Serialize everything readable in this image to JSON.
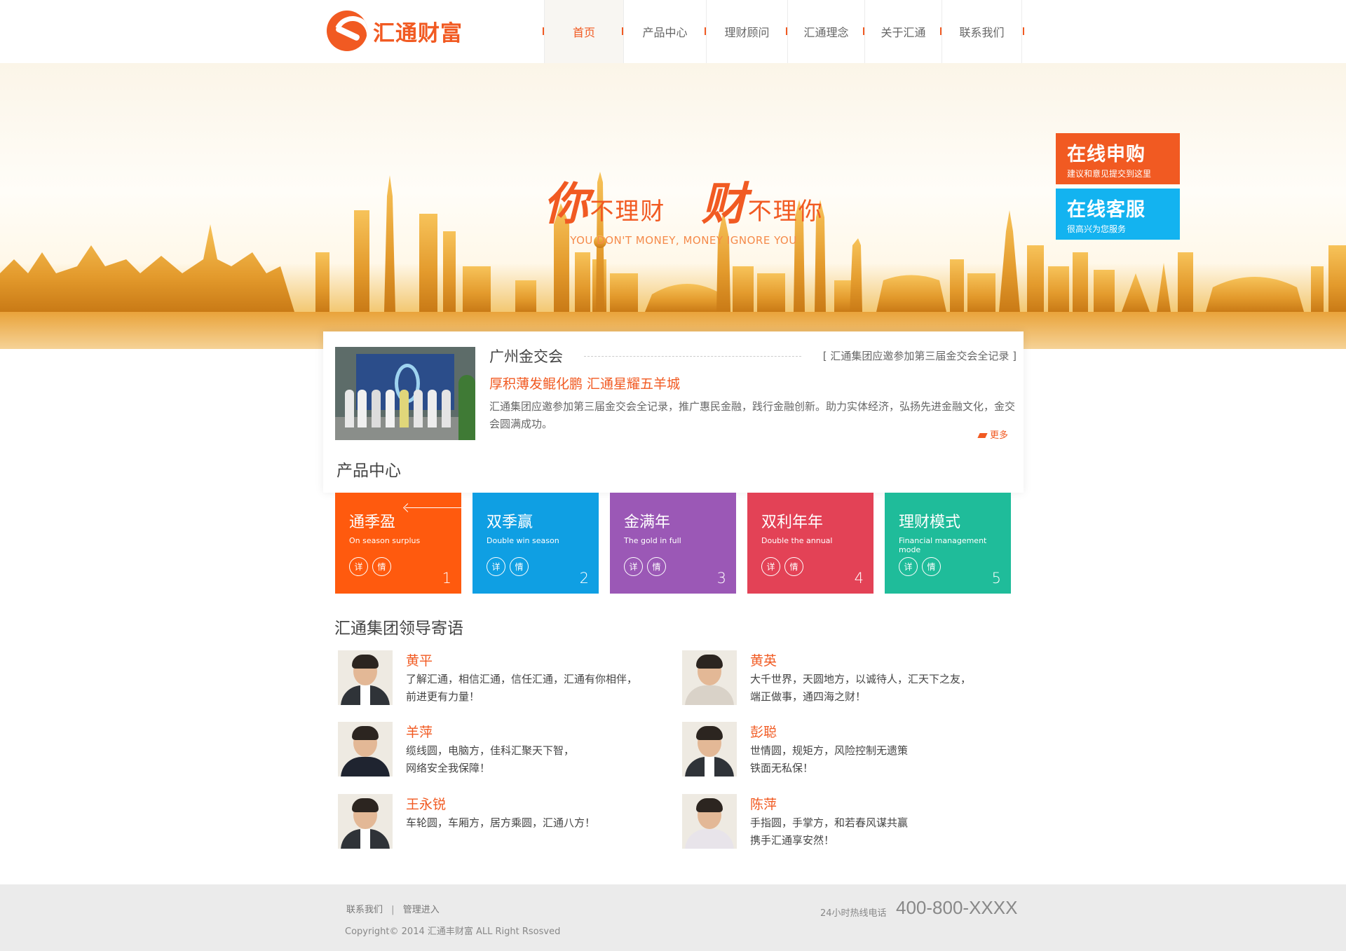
{
  "brand": {
    "name": "汇通财富"
  },
  "nav": {
    "items": [
      {
        "label": "首页",
        "active": true
      },
      {
        "label": "产品中心",
        "active": false
      },
      {
        "label": "理财顾问",
        "active": false
      },
      {
        "label": "汇通理念",
        "active": false
      },
      {
        "label": "关于汇通",
        "active": false
      },
      {
        "label": "联系我们",
        "active": false
      }
    ]
  },
  "banner": {
    "slogan_big1": "你",
    "slogan_small1": "不理财",
    "slogan_big2": "财",
    "slogan_small2": "不理你",
    "slogan_en": "YOU DON'T MONEY, MONEY IGNORE YOU",
    "slide_count": 3,
    "active_slide": 2
  },
  "side_buttons": {
    "apply": {
      "title": "在线申购",
      "subtitle": "建议和意见提交到这里"
    },
    "service": {
      "title": "在线客服",
      "subtitle": "很高兴为您服务"
    }
  },
  "news": {
    "title": "广州金交会",
    "tag": "[ 汇通集团应邀参加第三届金交会全记录 ]",
    "headline": "厚积薄发鲲化鹏 汇通星耀五羊城",
    "body": "汇通集团应邀参加第三届金交会全记录，推广惠民金融，践行金融创新。助力实体经济，弘扬先进金融文化，金交会圆满成功。",
    "more": "更多"
  },
  "products": {
    "title": "产品中心",
    "detail_chars": [
      "详",
      "情"
    ],
    "items": [
      {
        "name": "通季盈",
        "en": "On season surplus",
        "num": "1",
        "color": "#ff5a0e"
      },
      {
        "name": "双季赢",
        "en": "Double win season",
        "num": "2",
        "color": "#0f9fe3"
      },
      {
        "name": "金满年",
        "en": "The gold in full",
        "num": "3",
        "color": "#9b58b6"
      },
      {
        "name": "双利年年",
        "en": "Double the annual",
        "num": "4",
        "color": "#e34256"
      },
      {
        "name": "理财模式",
        "en": "Financial management mode",
        "num": "5",
        "color": "#1fbc9a"
      }
    ]
  },
  "leaders": {
    "title": "汇通集团领导寄语",
    "items": [
      {
        "name": "黄平",
        "line1": "了解汇通，相信汇通，信任汇通，汇通有你相伴，",
        "line2": "前进更有力量！"
      },
      {
        "name": "黄英",
        "line1": "大千世界，天圆地方，以诚待人，汇天下之友，",
        "line2": "端正做事，通四海之财！"
      },
      {
        "name": "羊萍",
        "line1": "缆线圆，电脑方，佳科汇聚天下智，",
        "line2": "网络安全我保障！"
      },
      {
        "name": "彭聪",
        "line1": "世情圆，规矩方，风险控制无遗策",
        "line2": "铁面无私保！"
      },
      {
        "name": "王永锐",
        "line1": "车轮圆，车厢方，居方乘圆，汇通八方！",
        "line2": ""
      },
      {
        "name": "陈萍",
        "line1": "手指圆，手掌方，和若春风谋共赢",
        "line2": "携手汇通享安然！"
      }
    ]
  },
  "footer": {
    "link_contact": "联系我们",
    "separator": "|",
    "link_admin": "管理进入",
    "copyright": "Copyright© 2014 汇通丰财富 ALL Right Rsosved",
    "hotline_label": "24小时热线电话",
    "phone": "400-800-XXXX"
  },
  "colors": {
    "accent": "#f15a22",
    "service_blue": "#13b3f0",
    "footer_bg": "#ebebeb"
  }
}
